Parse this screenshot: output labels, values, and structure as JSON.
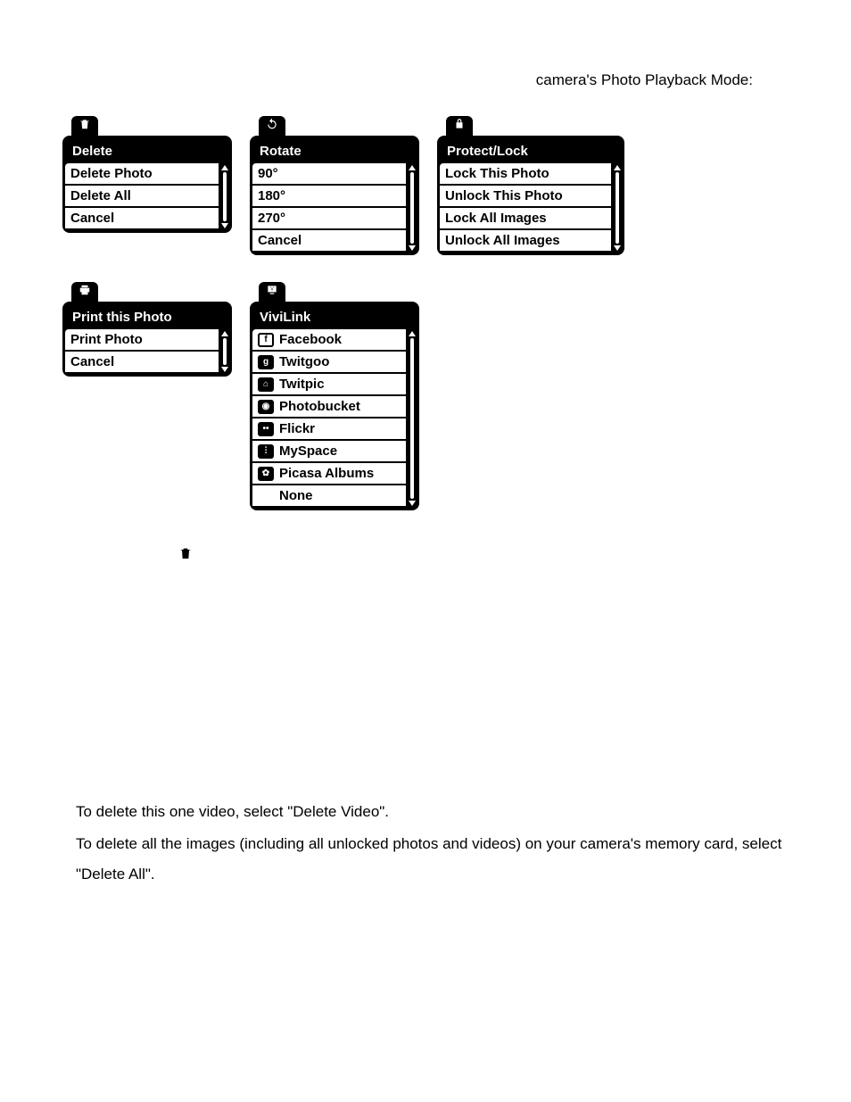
{
  "header": "camera's Photo Playback Mode:",
  "menus": {
    "delete": {
      "title": "Delete",
      "items": [
        "Delete Photo",
        "Delete All",
        "Cancel"
      ]
    },
    "rotate": {
      "title": "Rotate",
      "items": [
        "90°",
        "180°",
        "270°",
        "Cancel"
      ]
    },
    "protect": {
      "title": "Protect/Lock",
      "items": [
        "Lock This Photo",
        "Unlock This Photo",
        "Lock All Images",
        "Unlock All Images"
      ]
    },
    "print": {
      "title": "Print this Photo",
      "items": [
        "Print Photo",
        "Cancel"
      ]
    },
    "vivilink": {
      "title": "ViviLink",
      "items": [
        "Facebook",
        "Twitgoo",
        "Twitpic",
        "Photobucket",
        "Flickr",
        "MySpace",
        "Picasa Albums",
        "None"
      ]
    }
  },
  "body": {
    "p1": "To delete this one video, select \"Delete Video\".",
    "p2": "To delete all the images (including all unlocked photos and videos) on your camera's memory card, select \"Delete All\"."
  }
}
